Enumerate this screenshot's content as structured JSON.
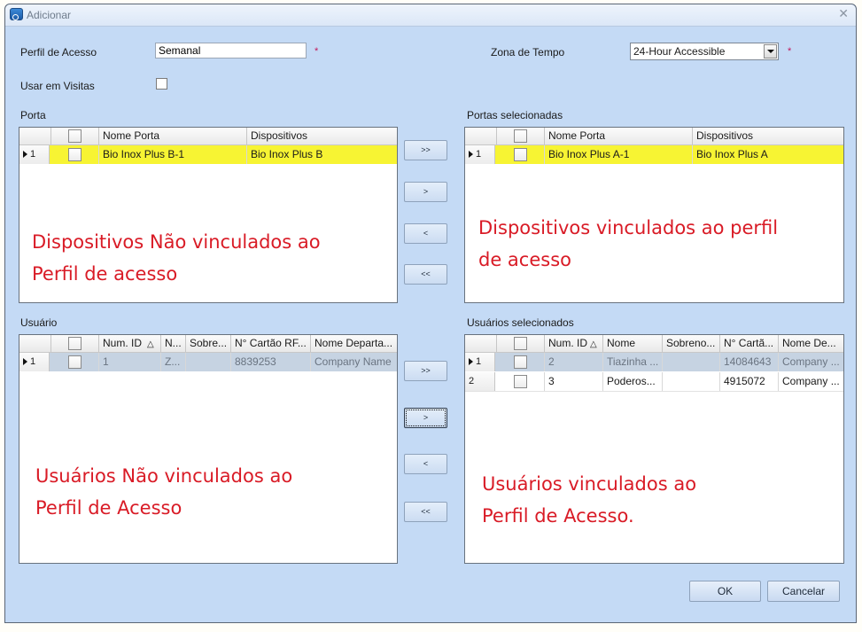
{
  "window": {
    "title": "Adicionar",
    "close_icon": "close-icon",
    "app_icon": "app-icon"
  },
  "form": {
    "access_profile_label": "Perfil de Acesso",
    "access_profile_value": "Semanal",
    "required_mark": "*",
    "time_zone_label": "Zona de Tempo",
    "time_zone_value": "24-Hour Accessible",
    "use_in_visits_label": "Usar em Visitas",
    "use_in_visits_checked": false
  },
  "doors": {
    "available": {
      "title": "Porta",
      "columns": [
        "Nome Porta",
        "Dispositivos"
      ],
      "rows": [
        {
          "index": "1",
          "name": "Bio Inox Plus B-1",
          "device": "Bio Inox Plus B",
          "current": true
        }
      ],
      "annotation_line1": "Dispositivos Não vinculados ao",
      "annotation_line2": "Perfil de acesso"
    },
    "selected": {
      "title": "Portas selecionadas",
      "columns": [
        "Nome Porta",
        "Dispositivos"
      ],
      "rows": [
        {
          "index": "1",
          "name": "Bio Inox Plus A-1",
          "device": "Bio Inox Plus A",
          "current": true
        }
      ],
      "annotation_line1": "Dispositivos vinculados ao perfil",
      "annotation_line2": "de acesso"
    },
    "buttons": {
      "add_all": ">>",
      "add": ">",
      "remove": "<",
      "remove_all": "<<"
    }
  },
  "users": {
    "available": {
      "title": "Usuário",
      "columns": [
        "Num. ID",
        "N...",
        "Sobre...",
        "N° Cartão RF...",
        "Nome Departa..."
      ],
      "sort_indicator": "△",
      "rows": [
        {
          "index": "1",
          "id": "1",
          "name": "Z...",
          "surname": "",
          "card": "8839253",
          "department": "Company Name",
          "current": true
        }
      ],
      "annotation_line1": "Usuários Não vinculados ao",
      "annotation_line2": "Perfil de Acesso"
    },
    "selected": {
      "title": "Usuários selecionados",
      "columns": [
        "Num. ID",
        "Nome",
        "Sobreno...",
        "N° Cartã...",
        "Nome De..."
      ],
      "sort_indicator": "△",
      "rows": [
        {
          "index": "1",
          "id": "2",
          "name": "Tiazinha ...",
          "surname": "",
          "card": "14084643",
          "department": "Company ...",
          "current": true
        },
        {
          "index": "2",
          "id": "3",
          "name": "Poderos...",
          "surname": "",
          "card": "4915072",
          "department": "Company ...",
          "current": false
        }
      ],
      "annotation_line1": "Usuários vinculados ao",
      "annotation_line2": "Perfil de Acesso."
    },
    "buttons": {
      "add_all": ">>",
      "add": ">",
      "remove": "<",
      "remove_all": "<<"
    }
  },
  "footer": {
    "ok_label": "OK",
    "cancel_label": "Cancelar"
  }
}
